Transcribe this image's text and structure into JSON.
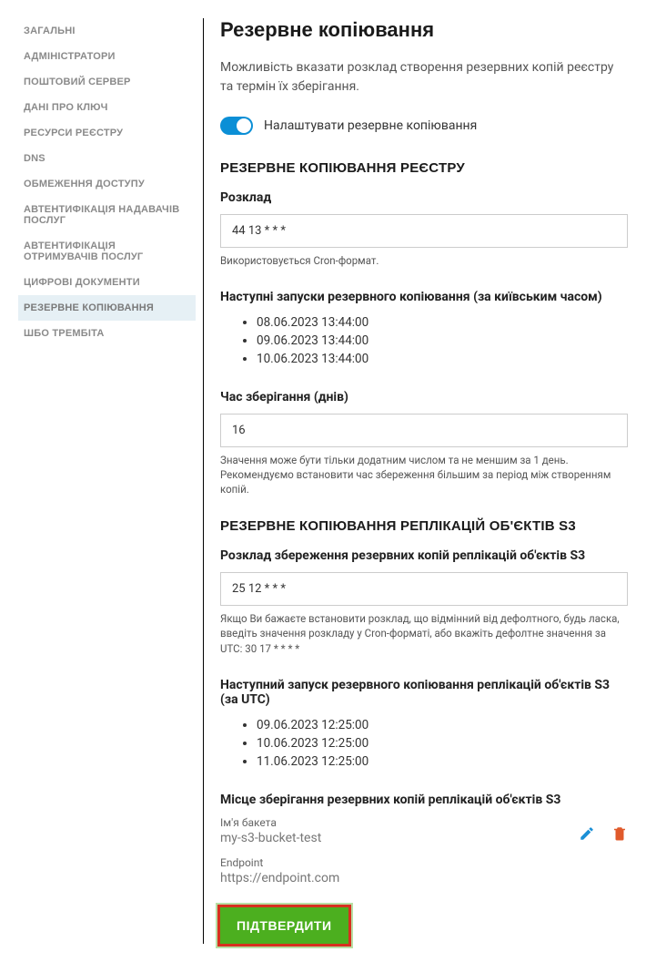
{
  "sidebar": {
    "items": [
      {
        "label": "Загальні"
      },
      {
        "label": "Адміністратори"
      },
      {
        "label": "Поштовий сервер"
      },
      {
        "label": "Дані про ключ"
      },
      {
        "label": "Ресурси реєстру"
      },
      {
        "label": "DNS"
      },
      {
        "label": "Обмеження доступу"
      },
      {
        "label": "Автентифікація надавачів послуг"
      },
      {
        "label": "Автентифікація отримувачів послуг"
      },
      {
        "label": "Цифрові документи"
      },
      {
        "label": "Резервне копіювання"
      },
      {
        "label": "ШБО Трембіта"
      }
    ],
    "activeIndex": 10
  },
  "main": {
    "title": "Резервне копіювання",
    "description": "Можливість вказати розклад створення резервних копій реєстру та термін їх зберігання.",
    "toggle": {
      "label": "Налаштувати резервне копіювання",
      "on": true
    },
    "registry": {
      "heading": "РЕЗЕРВНЕ КОПІЮВАННЯ РЕЄСТРУ",
      "schedule": {
        "label": "Розклад",
        "value": "44 13 * * *",
        "hint": "Використовується Cron-формат."
      },
      "nextRuns": {
        "label": "Наступні запуски резервного копіювання (за київським часом)",
        "items": [
          "08.06.2023 13:44:00",
          "09.06.2023 13:44:00",
          "10.06.2023 13:44:00"
        ]
      },
      "retention": {
        "label": "Час зберігання (днів)",
        "value": "16",
        "hint": "Значення може бути тільки додатним числом та не меншим за 1 день. Рекомендуємо встановити час збереження більшим за період між створенням копій."
      }
    },
    "s3": {
      "heading": "РЕЗЕРВНЕ КОПІЮВАННЯ РЕПЛІКАЦІЙ ОБ'ЄКТІВ S3",
      "schedule": {
        "label": "Розклад збереження резервних копій реплікацій об'єктів S3",
        "value": "25 12 * * *",
        "hint": "Якщо Ви бажаєте встановити розклад, що відмінний від дефолтного, будь ласка, введіть значення розкладу у Cron-форматі, або вкажіть дефолтне значення за UTC: 30 17 * * * *"
      },
      "nextRuns": {
        "label": "Наступний запуск резервного копіювання реплікацій об'єктів S3 (за UTC)",
        "items": [
          "09.06.2023 12:25:00",
          "10.06.2023 12:25:00",
          "11.06.2023 12:25:00"
        ]
      },
      "storage": {
        "label": "Місце зберігання резервних копій реплікацій об'єктів S3",
        "bucketLabel": "Ім'я бакета",
        "bucketValue": "my-s3-bucket-test",
        "endpointLabel": "Endpoint",
        "endpointValue": "https://endpoint.com"
      }
    },
    "confirmLabel": "ПІДТВЕРДИТИ"
  }
}
